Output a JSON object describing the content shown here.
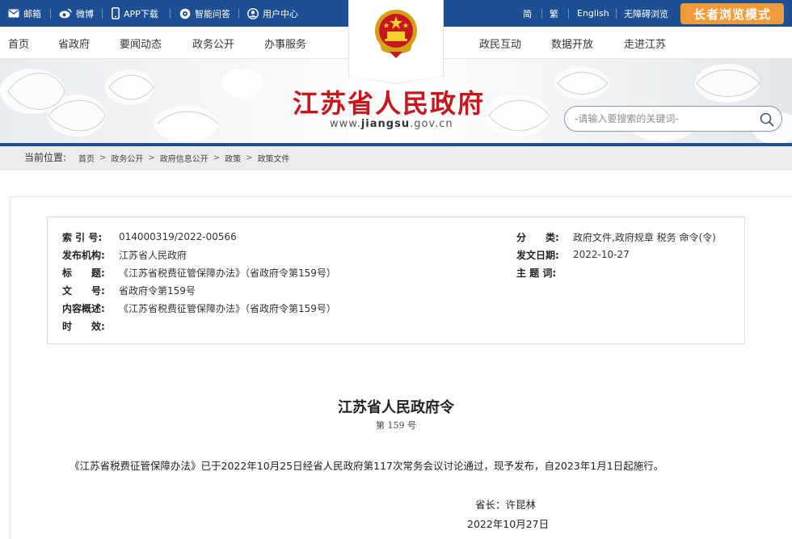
{
  "topbar": {
    "links": [
      {
        "icon": "mail-icon",
        "label": "邮箱"
      },
      {
        "icon": "weibo-icon",
        "label": "微博"
      },
      {
        "icon": "mobile-icon",
        "label": "APP下载"
      },
      {
        "icon": "qa-icon",
        "label": "智能问答"
      },
      {
        "icon": "user-icon",
        "label": "用户中心"
      }
    ],
    "right_links": [
      "简",
      "繁",
      "English",
      "无障碍浏览"
    ],
    "elder_mode": "长者浏览模式"
  },
  "nav": {
    "left": [
      "首页",
      "省政府",
      "要闻动态",
      "政务公开",
      "办事服务"
    ],
    "right": [
      "政民互动",
      "数据开放",
      "走进江苏"
    ]
  },
  "banner": {
    "title": "江苏省人民政府",
    "url_prefix": "www.",
    "url_domain": "jiangsu",
    "url_suffix": ".gov.cn",
    "search_placeholder": "-请输入要搜索的关键词-"
  },
  "breadcrumb": {
    "label": "当前位置:",
    "items": [
      "首页",
      "政务公开",
      "政府信息公开",
      "政策",
      "政策文件"
    ]
  },
  "meta": {
    "index_key": "索 引 号:",
    "index_val": "014000319/2022-00566",
    "issuer_key": "发布机构:",
    "issuer_val": "江苏省人民政府",
    "title_key": "标　　题:",
    "title_val": "《江苏省税费征管保障办法》（省政府令第159号）",
    "docno_key": "文　　号:",
    "docno_val": "省政府令第159号",
    "summary_key": "内容概述:",
    "summary_val": "《江苏省税费征管保障办法》（省政府令第159号）",
    "validity_key": "时　　效:",
    "validity_val": "",
    "category_key": "分　　类:",
    "category_val": "政府文件,政府规章 税务 命令(令)",
    "date_key": "发文日期:",
    "date_val": "2022-10-27",
    "topic_key": "主 题 词:",
    "topic_val": ""
  },
  "document": {
    "title": "江苏省人民政府令",
    "number": "第 159 号",
    "body": "《江苏省税费征管保障办法》已于2022年10月25日经省人民政府第117次常务会议讨论通过，现予发布，自2023年1月1日起施行。",
    "signature": "省长：许昆林",
    "date": "2022年10月27日"
  },
  "colors": {
    "primary_blue": "#1d4f95",
    "accent_orange": "#f29b3d",
    "title_red": "#c8161d"
  }
}
